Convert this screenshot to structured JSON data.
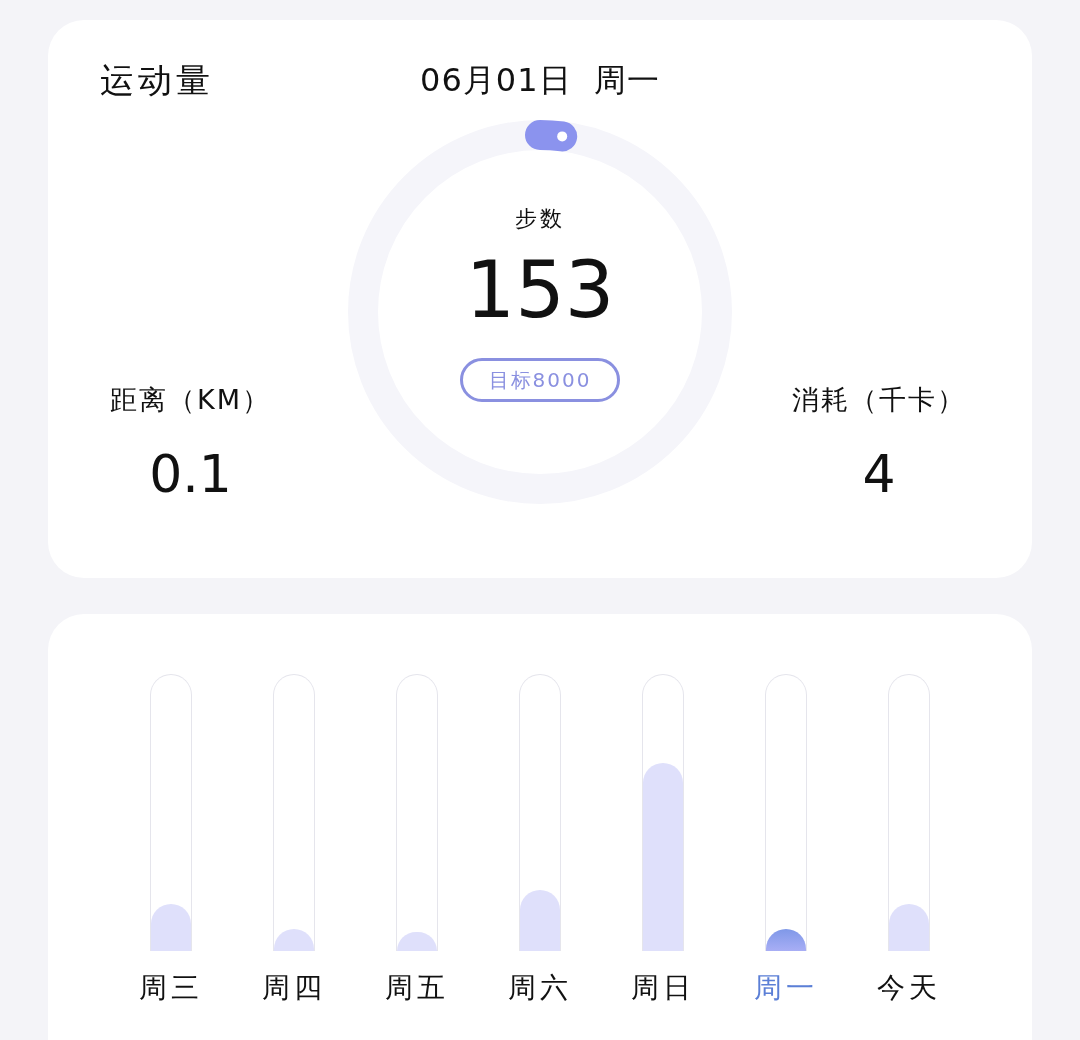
{
  "summary": {
    "title": "运动量",
    "date": "06月01日  周一",
    "steps": {
      "label": "步数",
      "value": "153",
      "goal": "目标8000"
    },
    "distance": {
      "label": "距离（KM）",
      "value": "0.1"
    },
    "calories": {
      "label": "消耗（千卡）",
      "value": "4"
    }
  },
  "week": {
    "days": [
      {
        "label": "周三",
        "level": 0.17,
        "selected": false
      },
      {
        "label": "周四",
        "level": 0.08,
        "selected": false
      },
      {
        "label": "周五",
        "level": 0.07,
        "selected": false
      },
      {
        "label": "周六",
        "level": 0.22,
        "selected": false
      },
      {
        "label": "周日",
        "level": 0.68,
        "selected": false
      },
      {
        "label": "周一",
        "level": 0.08,
        "selected": true
      },
      {
        "label": "今天",
        "level": 0.17,
        "selected": false
      }
    ]
  }
}
